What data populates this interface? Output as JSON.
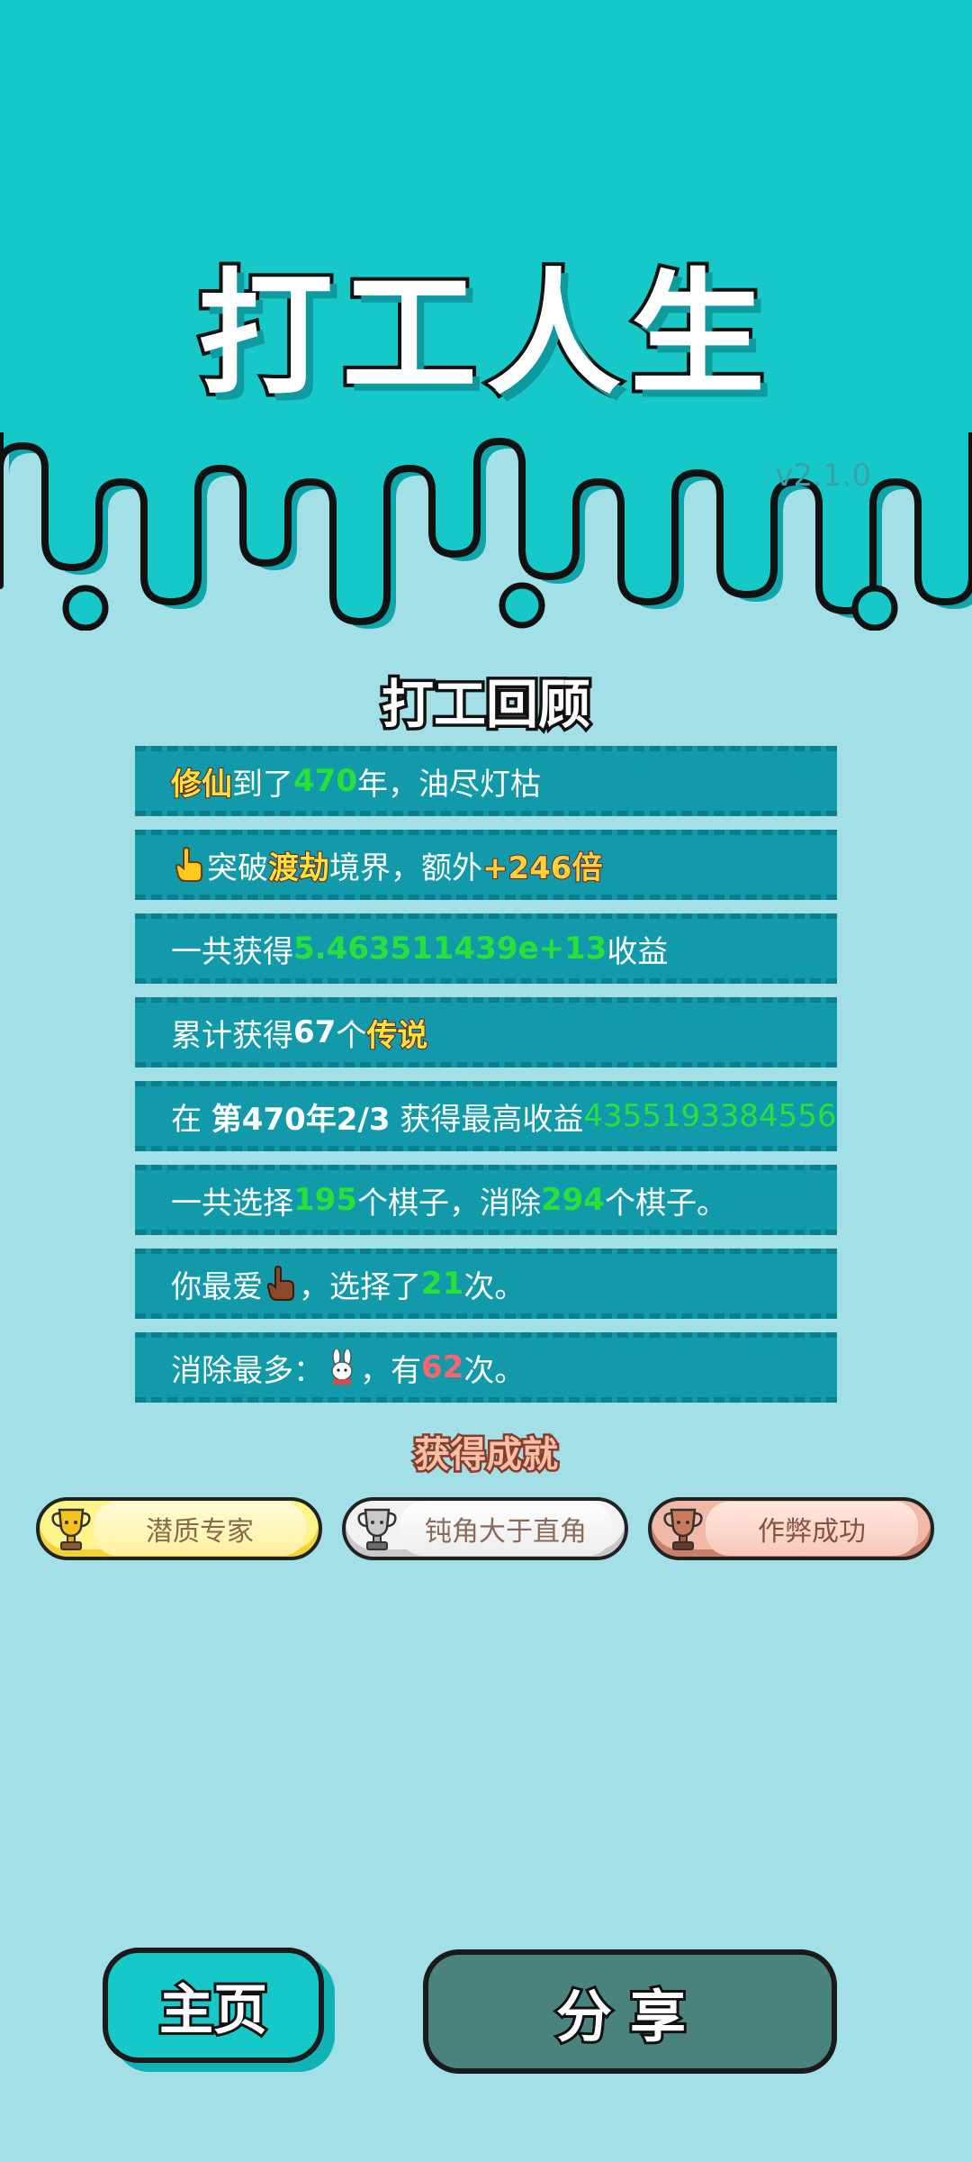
{
  "app": {
    "title": "打工人生",
    "version": "v2.1.0"
  },
  "review": {
    "title": "打工回顾",
    "rows": [
      {
        "a": "修仙",
        "b": "到了",
        "c": "470",
        "d": "年，油尽灯枯"
      },
      {
        "icon": "pointing-hand-icon",
        "a": "突破",
        "b": "渡劫",
        "c": "境界，额外",
        "d": "+246倍"
      },
      {
        "a": "一共获得",
        "b": "5.463511439e+13",
        "c": "收益"
      },
      {
        "a": "累计获得",
        "b": "67",
        "c": "个",
        "d": "传说"
      },
      {
        "a": "在",
        "b": "第470年2/3",
        "c": "获得最高收益",
        "d": "4355193384556"
      },
      {
        "a": "一共选择",
        "b": "195",
        "c": "个棋子，消除",
        "d": "294",
        "e": "个棋子。"
      },
      {
        "a": "你最爱",
        "icon": "pointing-hand-brown-icon",
        "b": "，选择了",
        "c": "21",
        "d": "次。"
      },
      {
        "a": "消除最多：",
        "icon": "rabbit-icon",
        "b": "，有",
        "c": "62",
        "d": "次。"
      }
    ]
  },
  "achievements": {
    "title": "获得成就",
    "items": [
      {
        "label": "潜质专家",
        "tier": "gold",
        "color": "#f1c232"
      },
      {
        "label": "钝角大于直角",
        "tier": "silver",
        "color": "#bdbdbd"
      },
      {
        "label": "作弊成功",
        "tier": "bronze",
        "color": "#c8806a"
      }
    ]
  },
  "buttons": {
    "home": "主页",
    "share": "分享"
  },
  "colors": {
    "teal": "#16c8c8",
    "page_bg": "#a3dfe7",
    "row_bg": "#139aaa",
    "highlight_green": "#28e03a",
    "share_button": "#4a827d"
  }
}
